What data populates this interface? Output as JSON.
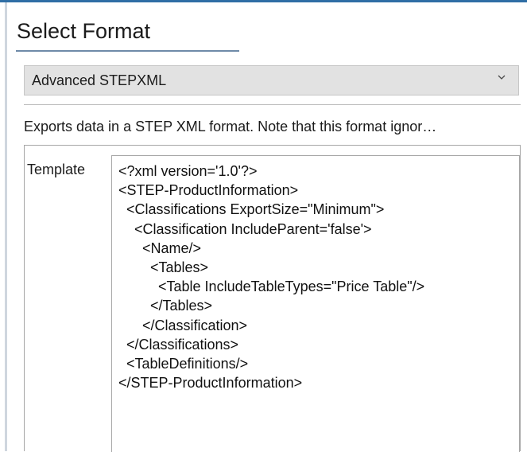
{
  "section": {
    "title": "Select Format"
  },
  "format_select": {
    "selected": "Advanced STEPXML",
    "icon": "chevron-down-icon"
  },
  "description": "Exports data in a STEP XML format. Note that this format ignor…",
  "template": {
    "label": "Template",
    "lines": [
      "<?xml version='1.0'?>",
      "<STEP-ProductInformation>",
      "  <Classifications ExportSize=\"Minimum\">",
      "    <Classification IncludeParent='false'>",
      "      <Name/>",
      "        <Tables>",
      "          <Table IncludeTableTypes=\"Price Table\"/>",
      "        </Tables>",
      "      </Classification>",
      "  </Classifications>",
      "  <TableDefinitions/>",
      "</STEP-ProductInformation>"
    ]
  },
  "colors": {
    "accent": "#2f6ea5",
    "select_background": "#e2e2e2"
  }
}
